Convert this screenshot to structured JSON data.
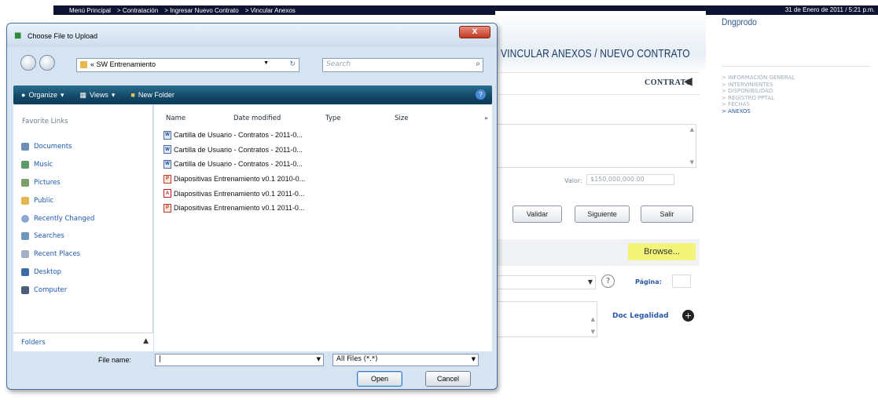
{
  "topbar": {
    "crumbs": [
      "Menú Principal",
      "> Contratación",
      "> Ingresar Nuevo Contrato",
      "> Vincular Anexos"
    ],
    "date": "31 de Enero de 2011 / 5:21 p.m."
  },
  "page": {
    "title": "VINCULAR ANEXOS / NUEVO CONTRATO",
    "contrato_label": "CONTRATO",
    "valor_label": "Valor:",
    "valor_value": "$150,000,000.00",
    "buttons": {
      "validar": "Validar",
      "siguiente": "Siguiente",
      "salir": "Salir"
    },
    "browse": "Browse...",
    "pagina_label": "Página:",
    "doc_legalidad": "Doc Legalidad"
  },
  "side": {
    "user": "Dngprodo",
    "menu": [
      "> INFORMACIÓN GENERAL",
      "> INTERVINIENTES",
      "> DISPONIBILIDAD",
      "> REGISTRO PPTAL",
      "> FECHAS",
      "> ANEXOS"
    ]
  },
  "dialog": {
    "title": "Choose File to Upload",
    "close": "X",
    "address": "« SW Entrenamiento",
    "search_placeholder": "Search",
    "toolbar": {
      "organize": "Organize",
      "views": "Views",
      "new_folder": "New Folder"
    },
    "favorites_title": "Favorite Links",
    "favorites": [
      "Documents",
      "Music",
      "Pictures",
      "Public",
      "Recently Changed",
      "Searches",
      "Recent Places",
      "Desktop",
      "Computer"
    ],
    "folders": "Folders",
    "columns": {
      "name": "Name",
      "date": "Date modified",
      "type": "Type",
      "size": "Size",
      "more": "»"
    },
    "files": [
      {
        "name": "Cartilla de Usuario - Contratos - 2011-0...",
        "kind": "doc"
      },
      {
        "name": "Cartilla de Usuario - Contratos - 2011-0...",
        "kind": "doc"
      },
      {
        "name": "Cartilla de Usuario - Contratos - 2011-0...",
        "kind": "doc"
      },
      {
        "name": "Diapositivas Entrenamiento v0.1 2010-0...",
        "kind": "ppt"
      },
      {
        "name": "Diapositivas Entrenamiento v0.1 2011-0...",
        "kind": "pdf"
      },
      {
        "name": "Diapositivas Entrenamiento v0.1 2011-0...",
        "kind": "ppt"
      }
    ],
    "file_name_label": "File name:",
    "file_name_value": "",
    "file_type": "All Files (*.*)",
    "open": "Open",
    "cancel": "Cancel"
  }
}
